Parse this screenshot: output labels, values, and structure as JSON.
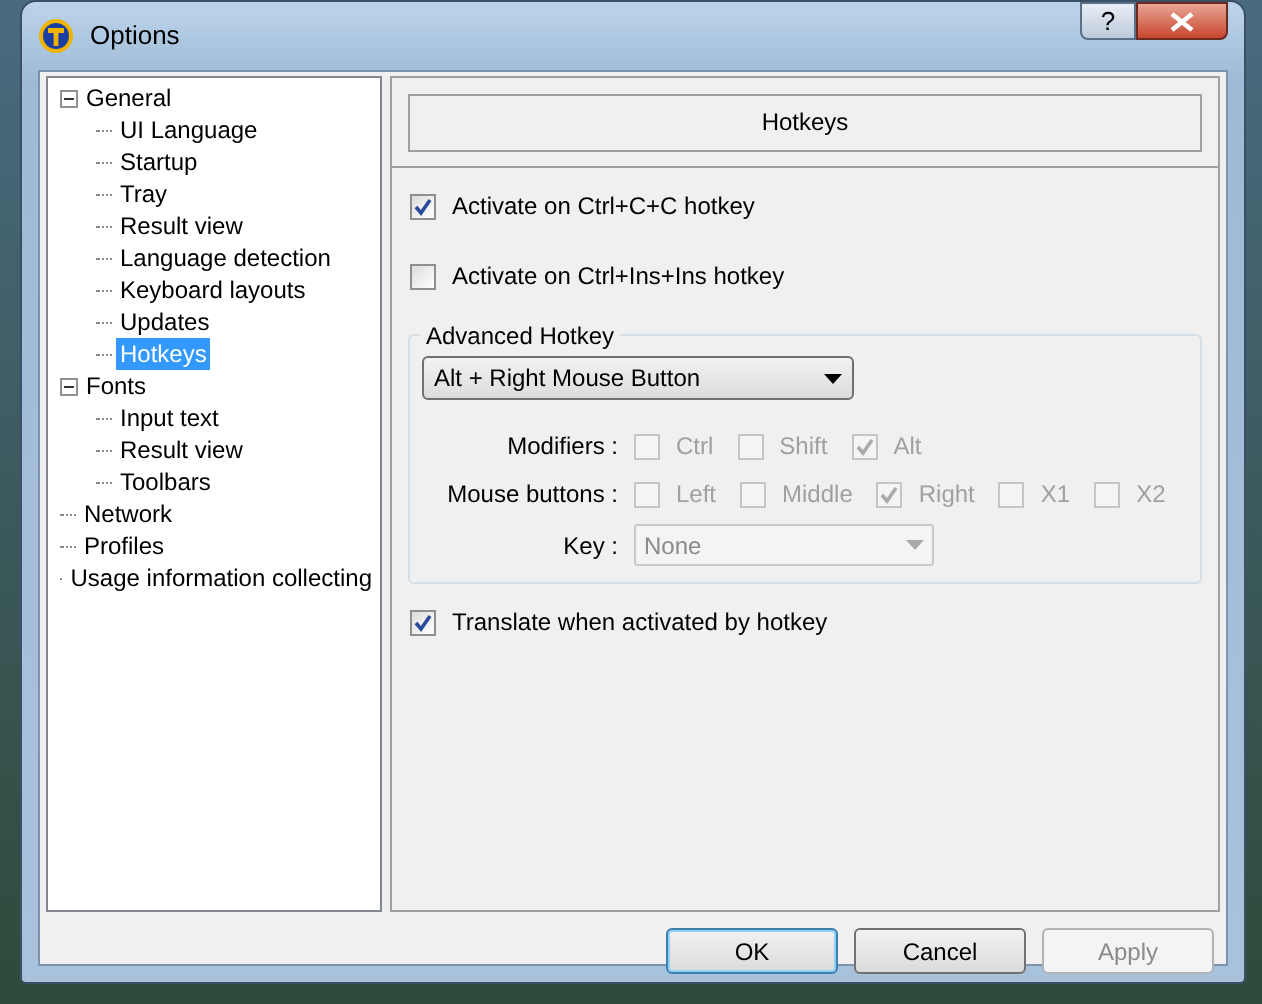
{
  "window": {
    "title": "Options",
    "help_button": "?"
  },
  "tree": [
    {
      "label": "General",
      "expanded": true,
      "selected": false,
      "children": [
        {
          "label": "UI Language",
          "selected": false
        },
        {
          "label": "Startup",
          "selected": false
        },
        {
          "label": "Tray",
          "selected": false
        },
        {
          "label": "Result view",
          "selected": false
        },
        {
          "label": "Language detection",
          "selected": false
        },
        {
          "label": "Keyboard layouts",
          "selected": false
        },
        {
          "label": "Updates",
          "selected": false
        },
        {
          "label": "Hotkeys",
          "selected": true
        }
      ]
    },
    {
      "label": "Fonts",
      "expanded": true,
      "selected": false,
      "children": [
        {
          "label": "Input text",
          "selected": false
        },
        {
          "label": "Result view",
          "selected": false
        },
        {
          "label": "Toolbars",
          "selected": false
        }
      ]
    },
    {
      "label": "Network",
      "selected": false
    },
    {
      "label": "Profiles",
      "selected": false
    },
    {
      "label": "Usage information collecting",
      "selected": false
    }
  ],
  "panel": {
    "title": "Hotkeys",
    "hotkey_options": [
      {
        "label": "Activate on Ctrl+C+C hotkey",
        "checked": true
      },
      {
        "label": "Activate on Ctrl+Ins+Ins hotkey",
        "checked": false
      }
    ],
    "advanced": {
      "title": "Advanced Hotkey",
      "dropdown": "Alt + Right Mouse Button",
      "rows": [
        {
          "kind": "checks",
          "label": "Modifiers :",
          "items": [
            {
              "label": "Ctrl",
              "checked": false,
              "disabled": true
            },
            {
              "label": "Shift",
              "checked": false,
              "disabled": true
            },
            {
              "label": "Alt",
              "checked": true,
              "disabled": true
            }
          ]
        },
        {
          "kind": "checks",
          "label": "Mouse buttons :",
          "items": [
            {
              "label": "Left",
              "checked": false,
              "disabled": true
            },
            {
              "label": "Middle",
              "checked": false,
              "disabled": true
            },
            {
              "label": "Right",
              "checked": true,
              "disabled": true
            },
            {
              "label": "X1",
              "checked": false,
              "disabled": true
            },
            {
              "label": "X2",
              "checked": false,
              "disabled": true
            }
          ]
        },
        {
          "kind": "select",
          "label": "Key :",
          "value": "None",
          "disabled": true
        }
      ]
    },
    "translate_option": {
      "label": "Translate when activated by hotkey",
      "checked": true
    }
  },
  "buttons": [
    {
      "label": "OK",
      "default": true,
      "disabled": false
    },
    {
      "label": "Cancel",
      "default": false,
      "disabled": false
    },
    {
      "label": "Apply",
      "default": false,
      "disabled": true
    }
  ]
}
